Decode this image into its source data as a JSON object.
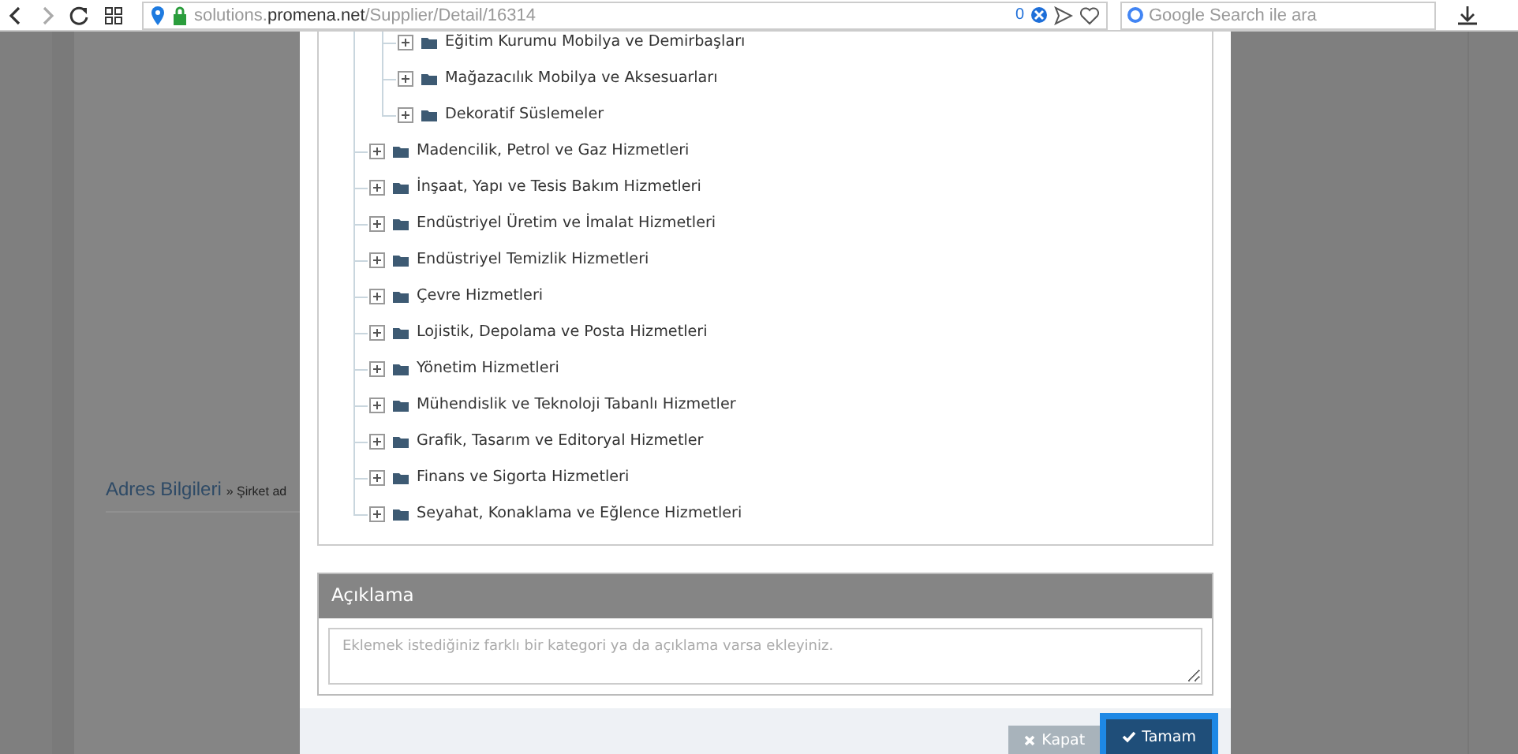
{
  "browser": {
    "url": {
      "subdomain": "solutions.",
      "domain": "promena.net",
      "path": "/Supplier/Detail/16314"
    },
    "badge": "0",
    "search": {
      "placeholder": "Google Search ile ara"
    }
  },
  "background": {
    "section_title": "Adres Bilgileri",
    "section_note": "» Şirket ad"
  },
  "tree": {
    "items": [
      {
        "children": [
          {
            "label": "Eğitim Kurumu Mobilya ve Demirbaşları",
            "expanded": false
          },
          {
            "label": "Mağazacılık Mobilya ve Aksesuarları",
            "expanded": false
          },
          {
            "label": "Dekoratif Süslemeler",
            "expanded": false
          }
        ]
      },
      {
        "label": "Madencilik, Petrol ve Gaz Hizmetleri",
        "expanded": false
      },
      {
        "label": "İnşaat, Yapı ve Tesis Bakım Hizmetleri",
        "expanded": false
      },
      {
        "label": "Endüstriyel Üretim ve İmalat Hizmetleri",
        "expanded": false
      },
      {
        "label": "Endüstriyel Temizlik Hizmetleri",
        "expanded": false
      },
      {
        "label": "Çevre Hizmetleri",
        "expanded": false
      },
      {
        "label": "Lojistik, Depolama ve Posta Hizmetleri",
        "expanded": false
      },
      {
        "label": "Yönetim Hizmetleri",
        "expanded": false
      },
      {
        "label": "Mühendislik ve Teknoloji Tabanlı Hizmetler",
        "expanded": false
      },
      {
        "label": "Grafik, Tasarım ve Editoryal Hizmetler",
        "expanded": false
      },
      {
        "label": "Finans ve Sigorta Hizmetleri",
        "expanded": false
      },
      {
        "label": "Seyahat, Konaklama ve Eğlence Hizmetleri",
        "expanded": false
      }
    ]
  },
  "description": {
    "title": "Açıklama",
    "placeholder": "Eklemek istediğiniz farklı bir kategori ya da açıklama varsa ekleyiniz."
  },
  "buttons": [
    {
      "label": "Kapat",
      "kind": "close"
    },
    {
      "label": "Tamam",
      "kind": "confirm"
    }
  ]
}
